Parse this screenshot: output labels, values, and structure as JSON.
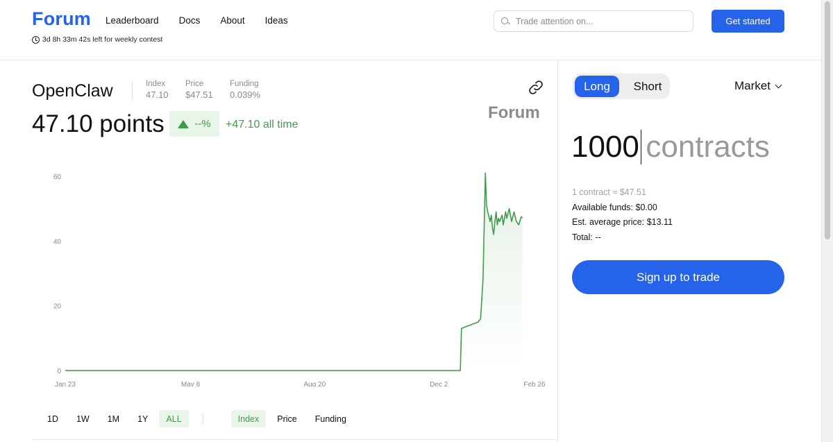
{
  "header": {
    "logo": "Forum",
    "nav": [
      "Leaderboard",
      "Docs",
      "About",
      "Ideas"
    ],
    "countdown": "3d 8h 33m 42s left for weekly contest",
    "search_placeholder": "Trade attention on...",
    "cta": "Get started"
  },
  "asset": {
    "name": "OpenClaw",
    "stats": [
      {
        "label": "Index",
        "value": "47.10"
      },
      {
        "label": "Price",
        "value": "$47.51"
      },
      {
        "label": "Funding",
        "value": "0.039%"
      }
    ],
    "brand": "Forum",
    "points": "47.10 points",
    "change_pct": "--%",
    "all_time": "+47.10 all time"
  },
  "chart_data": {
    "type": "area",
    "title": "",
    "xlabel": "",
    "ylabel": "",
    "x_ticks": [
      "Jan 23",
      "May 8",
      "Aug 20",
      "Dec 2",
      "Feb 26"
    ],
    "y_ticks": [
      0,
      20,
      40,
      60
    ],
    "ylim": [
      0,
      60
    ],
    "grid": false,
    "color": "#3f9c4a",
    "series": [
      {
        "values": [
          [
            "2025-01-23",
            0
          ],
          [
            "2025-06-01",
            0
          ],
          [
            "2025-11-01",
            0
          ],
          [
            "2025-12-20",
            0
          ],
          [
            "2025-12-21",
            13
          ],
          [
            "2026-01-04",
            15
          ],
          [
            "2026-01-06",
            16
          ],
          [
            "2026-01-08",
            28
          ],
          [
            "2026-01-10",
            61
          ],
          [
            "2026-01-11",
            51
          ],
          [
            "2026-01-12",
            49
          ],
          [
            "2026-01-13",
            47.5
          ],
          [
            "2026-01-14",
            46
          ],
          [
            "2026-01-15",
            48
          ],
          [
            "2026-01-16",
            44
          ],
          [
            "2026-01-17",
            42
          ],
          [
            "2026-01-18",
            46
          ],
          [
            "2026-01-19",
            49
          ],
          [
            "2026-01-20",
            45
          ],
          [
            "2026-01-21",
            47
          ],
          [
            "2026-01-22",
            46
          ],
          [
            "2026-01-24",
            48
          ],
          [
            "2026-01-25",
            45
          ],
          [
            "2026-01-27",
            49
          ],
          [
            "2026-01-28",
            47
          ],
          [
            "2026-01-30",
            50
          ],
          [
            "2026-02-01",
            46
          ],
          [
            "2026-02-03",
            49
          ],
          [
            "2026-02-05",
            46
          ],
          [
            "2026-02-07",
            45
          ],
          [
            "2026-02-09",
            47.5
          ],
          [
            "2026-02-10",
            47.1
          ]
        ]
      }
    ]
  },
  "ranges": [
    "1D",
    "1W",
    "1M",
    "1Y",
    "ALL"
  ],
  "active_range": "ALL",
  "metrics": [
    "Index",
    "Price",
    "Funding"
  ],
  "active_metric": "Index",
  "trade": {
    "long": "Long",
    "short": "Short",
    "order_type": "Market",
    "amount": "1000",
    "unit": "contracts",
    "contract_value": "1 contract ≈ $47.51",
    "available_funds": "Available funds: $0.00",
    "avg_price": "Est. average price: $13.11",
    "total": "Total: --",
    "signup": "Sign up to trade"
  }
}
